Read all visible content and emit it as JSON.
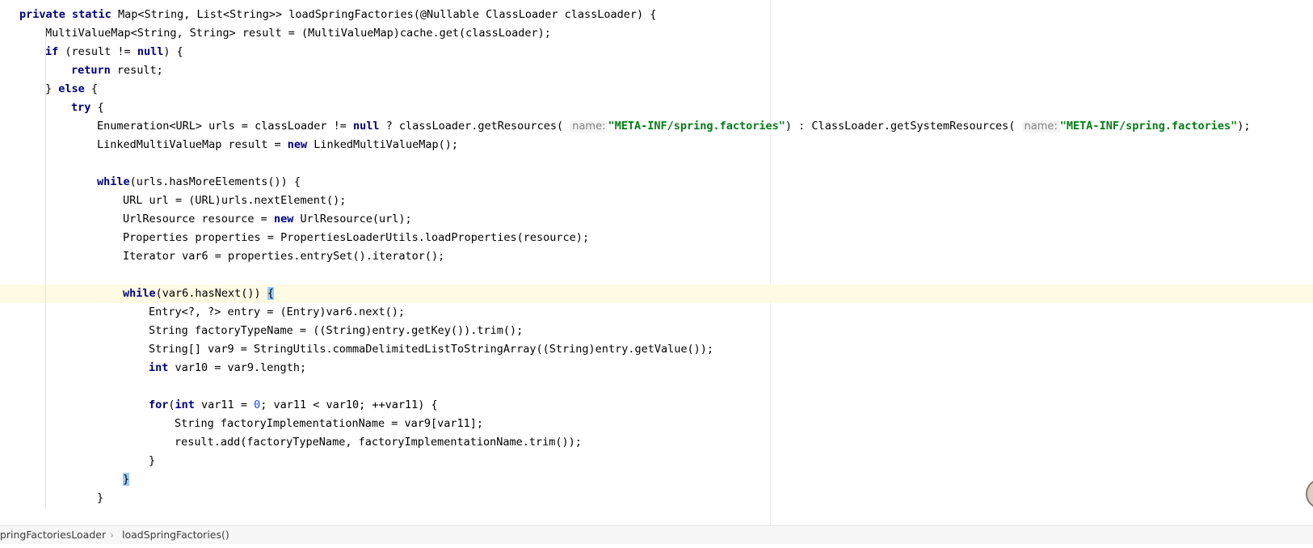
{
  "editor": {
    "lines": [
      [
        {
          "t": "private",
          "c": "kw"
        },
        {
          "t": " "
        },
        {
          "t": "static",
          "c": "kw"
        },
        {
          "t": " Map<String, List<String>> loadSpringFactories(@Nullable ClassLoader classLoader) {"
        }
      ],
      [
        {
          "t": "MultiValueMap<String, String> result = (MultiValueMap)cache.get(classLoader);"
        }
      ],
      [
        {
          "t": "if",
          "c": "kw"
        },
        {
          "t": " (result != "
        },
        {
          "t": "null",
          "c": "kw"
        },
        {
          "t": ") {"
        }
      ],
      [
        {
          "t": "return",
          "c": "kw"
        },
        {
          "t": " result;"
        }
      ],
      [
        {
          "t": "} "
        },
        {
          "t": "else",
          "c": "kw"
        },
        {
          "t": " {"
        }
      ],
      [
        {
          "t": "try",
          "c": "kw"
        },
        {
          "t": " {"
        }
      ],
      [
        {
          "t": "Enumeration<URL> urls = classLoader != "
        },
        {
          "t": "null",
          "c": "kw"
        },
        {
          "t": " ? classLoader.getResources("
        },
        {
          "t": "name:",
          "c": "hint"
        },
        {
          "t": "\"META-INF/spring.factories\"",
          "c": "str"
        },
        {
          "t": ") : ClassLoader.getSystemResources("
        },
        {
          "t": "name:",
          "c": "hint"
        },
        {
          "t": "\"META-INF/spring.factories\"",
          "c": "str"
        },
        {
          "t": ");"
        }
      ],
      [
        {
          "t": "LinkedMultiValueMap result = "
        },
        {
          "t": "new",
          "c": "kw"
        },
        {
          "t": " LinkedMultiValueMap();"
        }
      ],
      [],
      [
        {
          "t": "while",
          "c": "kw"
        },
        {
          "t": "(urls.hasMoreElements()) {"
        }
      ],
      [
        {
          "t": "URL url = (URL)urls.nextElement();"
        }
      ],
      [
        {
          "t": "UrlResource resource = "
        },
        {
          "t": "new",
          "c": "kw"
        },
        {
          "t": " UrlResource(url);"
        }
      ],
      [
        {
          "t": "Properties properties = PropertiesLoaderUtils.loadProperties(resource);"
        }
      ],
      [
        {
          "t": "Iterator var6 = properties.entrySet().iterator();"
        }
      ],
      [],
      [
        {
          "t": "while",
          "c": "kw"
        },
        {
          "t": "(var6.hasNext()) "
        },
        {
          "t": "{",
          "c": "brace-match"
        }
      ],
      [
        {
          "t": "Entry<?, ?> entry = (Entry)var6.next();"
        }
      ],
      [
        {
          "t": "String factoryTypeName = ((String)entry.getKey()).trim();"
        }
      ],
      [
        {
          "t": "String[] var9 = StringUtils.commaDelimitedListToStringArray((String)entry.getValue());"
        }
      ],
      [
        {
          "t": "int",
          "c": "kw"
        },
        {
          "t": " var10 = var9.length;"
        }
      ],
      [],
      [
        {
          "t": "for",
          "c": "kw"
        },
        {
          "t": "("
        },
        {
          "t": "int",
          "c": "kw"
        },
        {
          "t": " var11 = "
        },
        {
          "t": "0",
          "c": "num"
        },
        {
          "t": "; var11 < var10; ++var11) {"
        }
      ],
      [
        {
          "t": "String factoryImplementationName = var9[var11];"
        }
      ],
      [
        {
          "t": "result.add(factoryTypeName, factoryImplementationName.trim());"
        }
      ],
      [
        {
          "t": "}"
        }
      ],
      [
        {
          "t": "}",
          "c": "brace-match"
        }
      ],
      [
        {
          "t": "}"
        }
      ]
    ]
  },
  "breadcrumb": {
    "class_name": "SpringFactoriesLoader",
    "separator": "›",
    "method_name": "loadSpringFactories()"
  },
  "colors": {
    "keyword": "#000080",
    "string": "#067d17",
    "number": "#1750eb",
    "current_line": "#fffae3",
    "brace_match": "#99ccff"
  }
}
